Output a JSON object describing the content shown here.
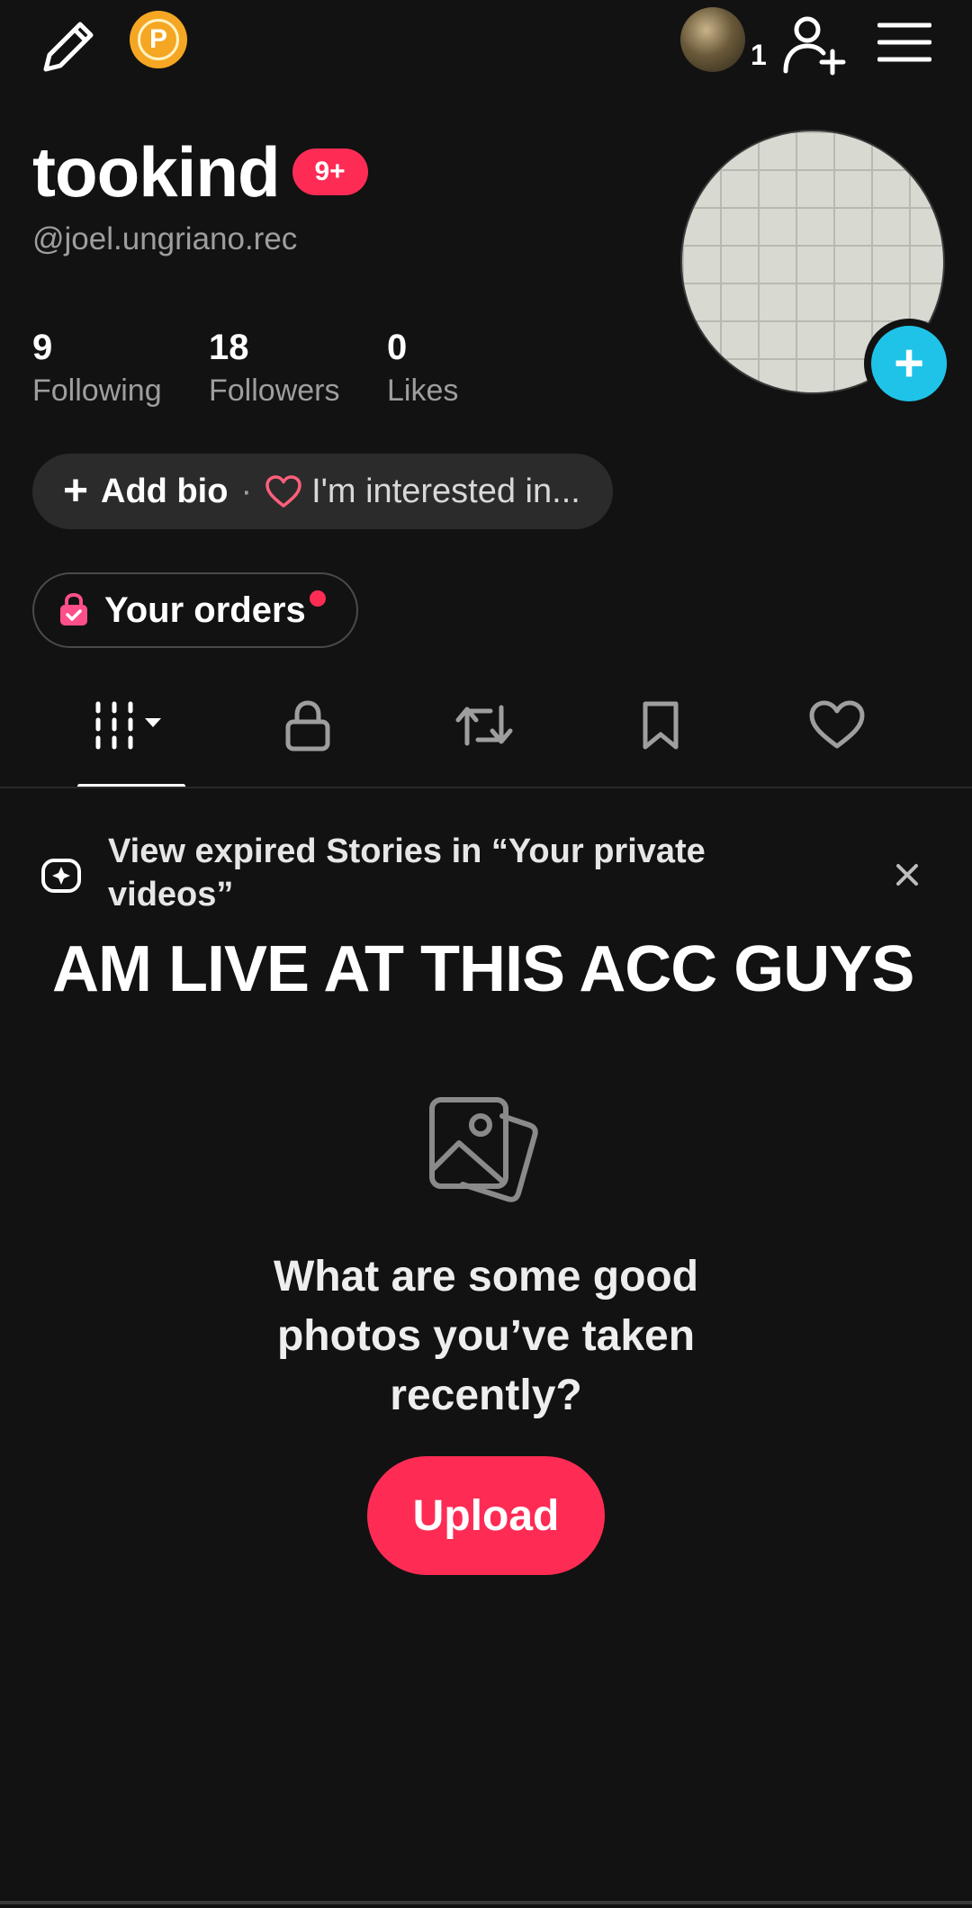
{
  "top_bar": {
    "points_label": "P",
    "mini_avatar_count": "1",
    "icons": [
      "edit-pencil-icon",
      "points-coin-icon",
      "add-friend-icon",
      "menu-icon"
    ]
  },
  "profile": {
    "display_name": "tookind",
    "notification_badge": "9+",
    "handle": "@joel.ungriano.rec",
    "stats": [
      {
        "value": "9",
        "label": "Following"
      },
      {
        "value": "18",
        "label": "Followers"
      },
      {
        "value": "0",
        "label": "Likes"
      }
    ],
    "add_bio_label": "Add bio",
    "bio_separator": "·",
    "interests_label": "I'm interested in...",
    "orders_label": "Your orders"
  },
  "tabs": [
    {
      "name": "videos-grid",
      "icon": "grid-icon",
      "active": true
    },
    {
      "name": "private",
      "icon": "lock-icon",
      "active": false
    },
    {
      "name": "reposts",
      "icon": "repost-icon",
      "active": false
    },
    {
      "name": "favorites",
      "icon": "bookmark-icon",
      "active": false
    },
    {
      "name": "liked",
      "icon": "heart-icon",
      "active": false
    }
  ],
  "story_banner": {
    "text_line1": "View expired Stories in “Your private",
    "text_line2": "videos”"
  },
  "overlay_caption": "AM LIVE AT THIS ACC GUYS",
  "empty_state": {
    "line1": "What are some good",
    "line2": "photos you’ve taken",
    "line3": "recently?",
    "upload_label": "Upload"
  },
  "colors": {
    "background": "#121212",
    "accent_red": "#fe2c55",
    "accent_cyan": "#20c3e8",
    "points_gold": "#f5a623"
  }
}
